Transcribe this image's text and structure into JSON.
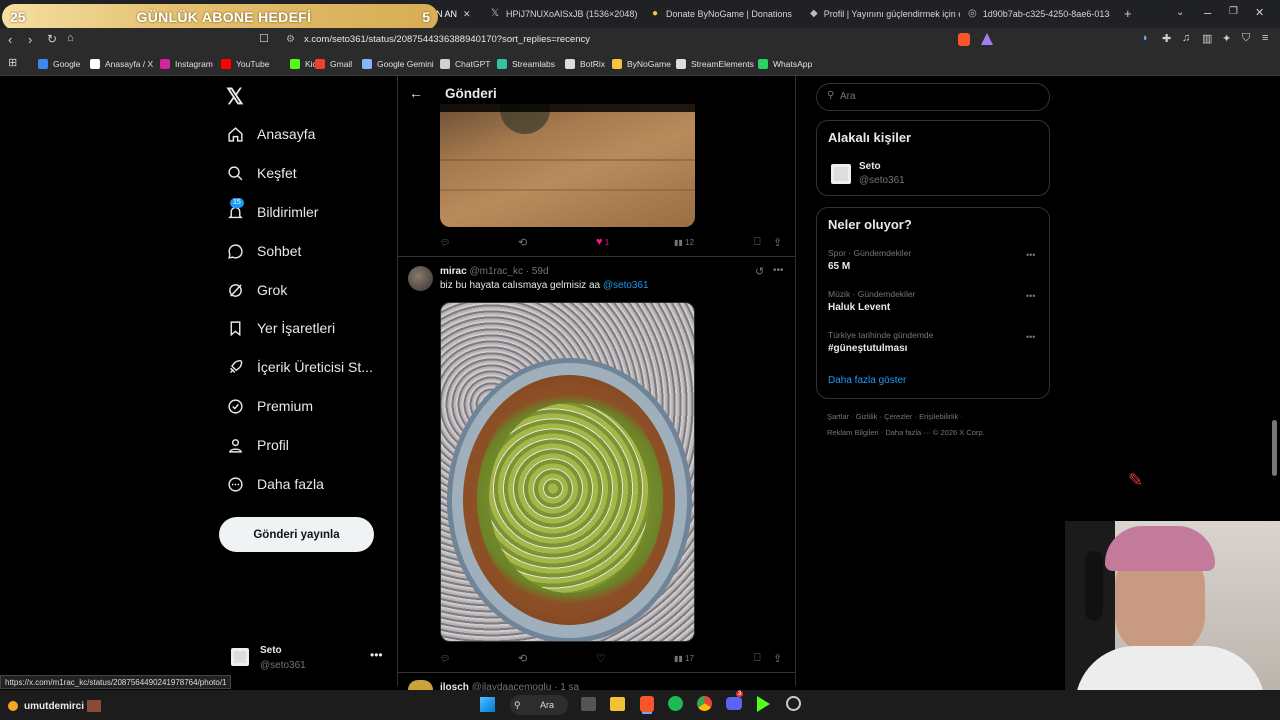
{
  "browser": {
    "goal_label": "GÜNLÜK ABONE HEDEFİ",
    "goal_left": "25",
    "goal_right": "5",
    "tab_partial": "N AN",
    "tabs": [
      {
        "label": "HPiJ7NUXoAISxJB (1536×2048)",
        "icon": "x-icon"
      },
      {
        "label": "Donate ByNoGame | Donations",
        "icon": "bynogame-icon"
      },
      {
        "label": "Profil | Yayınını güçlendirmek için e",
        "icon": "streamelements-icon"
      },
      {
        "label": "1d90b7ab-c325-4250-8ae6-0134d9",
        "icon": "globe-icon"
      }
    ],
    "url": "x.com/seto361/status/2087544336388940170?sort_replies=recency",
    "bookmarks": [
      {
        "label": "Google",
        "color": "#4285f4"
      },
      {
        "label": "Anasayfa / X",
        "color": "#ffffff"
      },
      {
        "label": "Instagram",
        "color": "#d6249f"
      },
      {
        "label": "YouTube",
        "color": "#ff0000"
      },
      {
        "label": "Kick",
        "color": "#53fc18"
      },
      {
        "label": "Gmail",
        "color": "#ea4335"
      },
      {
        "label": "Google Gemini",
        "color": "#8ab4f8"
      },
      {
        "label": "ChatGPT",
        "color": "#d0d0d0"
      },
      {
        "label": "Streamlabs",
        "color": "#31c3a2"
      },
      {
        "label": "BotRix",
        "color": "#dddddd"
      },
      {
        "label": "ByNoGame",
        "color": "#f5c542"
      },
      {
        "label": "StreamElements",
        "color": "#dddddd"
      },
      {
        "label": "WhatsApp",
        "color": "#25d366"
      }
    ]
  },
  "nav": {
    "items": [
      "Anasayfa",
      "Keşfet",
      "Bildirimler",
      "Sohbet",
      "Grok",
      "Yer İşaretleri",
      "İçerik Üreticisi St...",
      "Premium",
      "Profil",
      "Daha fazla"
    ],
    "notif_badge": "15",
    "post_button": "Gönderi yayınla",
    "account_name": "Seto",
    "account_handle": "@seto361"
  },
  "center": {
    "header_title": "Gönderi",
    "post1": {
      "likes": "1",
      "views": "12"
    },
    "post2": {
      "name": "mirac",
      "handle": "@m1rac_kc",
      "time": "· 59d",
      "text": "biz bu hayata calısmaya gelmisiz aa",
      "mention": "@seto361",
      "views": "17"
    },
    "post3": {
      "name": "ilosch",
      "handle": "@ilaydaacemoglu",
      "time": "· 1 sa"
    }
  },
  "right": {
    "search_placeholder": "Ara",
    "people_title": "Alakalı kişiler",
    "person_name": "Seto",
    "person_handle": "@seto361",
    "trends_title": "Neler oluyor?",
    "trends": [
      {
        "sub": "Spor · Gündemdekiler",
        "title": "65 M"
      },
      {
        "sub": "Müzik · Gündemdekiler",
        "title": "Haluk Levent"
      },
      {
        "sub": "Türkiye tarihinde gündemde",
        "title": "#güneştutulması"
      }
    ],
    "show_more": "Daha fazla göster",
    "footer1": "Şartlar · Gizlilik · Çerezler · Erişilebilirlik ·",
    "footer2": "Reklam Bilgileri · Daha fazla ··· © 2026 X Corp."
  },
  "status_url": "https://x.com/m1rac_kc/status/2087564490241978764/photo/1",
  "stream_user": "umutdemirci",
  "taskbar_search": "Ara",
  "taskbar_badge": "3"
}
